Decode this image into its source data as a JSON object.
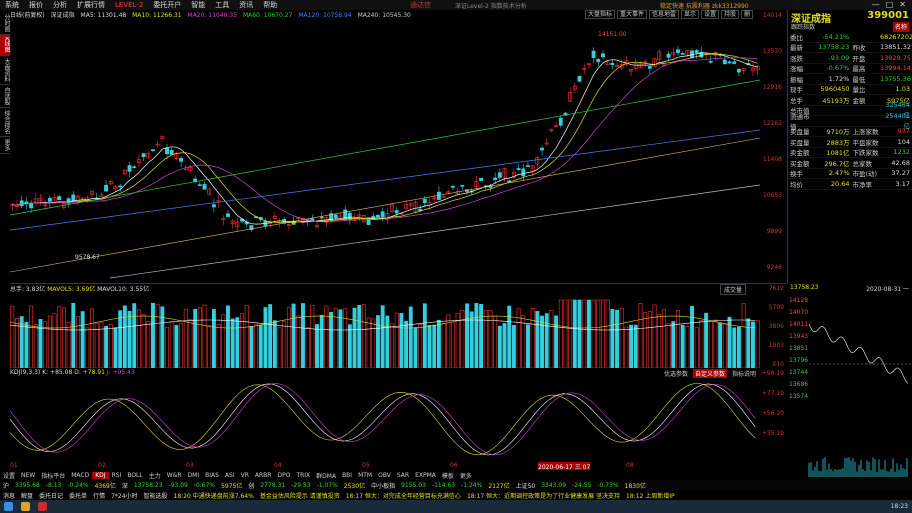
{
  "menu": [
    "系统",
    "报价",
    "分析",
    "扩展行情",
    "LEVEL-2",
    "委托开户",
    "智能",
    "工具",
    "资讯",
    "帮助"
  ],
  "app_title": "通达信",
  "window_subtitle": "深证Level-2  指数技术分析",
  "window_controls": [
    "—",
    "□",
    "✕"
  ],
  "brand_text": "稳定快速 抗震利器  zkk3312990",
  "left_tabs": [
    {
      "label": "分时图",
      "active": false
    },
    {
      "label": "K线图",
      "active": true
    },
    {
      "label": "大盘资料",
      "active": false
    },
    {
      "label": "自选股",
      "active": false
    },
    {
      "label": "综合排名",
      "active": false
    },
    {
      "label": "更多",
      "active": false
    }
  ],
  "header": {
    "period": "日线(前复权)",
    "name": "深证成指",
    "ma5": "MA5: 11301.48",
    "ma10": "MA10: 11266.31",
    "ma20": "MA20: 11046.35",
    "ma60": "MA60: 10670.27",
    "ma120": "MA120: 10758.94",
    "ma240": "MA240: 10545.30"
  },
  "tools": [
    "大盘指标",
    "重大事件",
    "信息地雷",
    "显示",
    "设置",
    "持股",
    "删"
  ],
  "price_axis": [
    "14014",
    "13570",
    "12916",
    "12162",
    "11408",
    "10653",
    "9899",
    "9246"
  ],
  "annotations": {
    "high": "14151.00",
    "low": "9578.67"
  },
  "right_panel": {
    "title": "深证成指",
    "code": "399001",
    "sub_left": "跟踪指数",
    "sub_right": "名称",
    "rows": [
      {
        "l": "委比",
        "v": "-54.21%",
        "l2": "",
        "v2": "68267202",
        "c": "dn",
        "c2": "yw"
      },
      {
        "l": "最新",
        "v": "13758.23",
        "l2": "昨收",
        "v2": "13851.32",
        "c": "dn",
        "c2": "wh"
      },
      {
        "l": "涨跌",
        "v": "-93.09",
        "l2": "开盘",
        "v2": "13929.75",
        "c": "dn",
        "c2": "up"
      },
      {
        "l": "涨幅",
        "v": "-0.67%",
        "l2": "最高",
        "v2": "13994.14",
        "c": "dn",
        "c2": "up"
      },
      {
        "l": "振幅",
        "v": "1.72%",
        "l2": "最低",
        "v2": "13755.36",
        "c": "wh",
        "c2": "dn"
      },
      {
        "l": "现手",
        "v": "5960450",
        "l2": "量比",
        "v2": "1.03",
        "c": "yw",
        "c2": "yw"
      },
      {
        "l": "总手",
        "v": "45193万",
        "l2": "金额",
        "v2": "5975亿",
        "c": "yw",
        "c2": "yw"
      },
      {
        "l": "总市值",
        "v": "",
        "l2": "",
        "v2": "325464亿",
        "c": "yw",
        "c2": "cy"
      },
      {
        "l": "流通市值",
        "v": "",
        "l2": "",
        "v2": "254401亿",
        "c": "yw",
        "c2": "cy"
      },
      {
        "l": "卖盘量",
        "v": "9710万",
        "l2": "上涨家数",
        "v2": "937",
        "c": "yw",
        "c2": "up"
      },
      {
        "l": "买盘量",
        "v": "2883万",
        "l2": "平盘家数",
        "v2": "104",
        "c": "yw",
        "c2": "wh"
      },
      {
        "l": "卖金额",
        "v": "1081亿",
        "l2": "下跌家数",
        "v2": "1232",
        "c": "yw",
        "c2": "dn"
      },
      {
        "l": "买金额",
        "v": "296.7亿",
        "l2": "总家数",
        "v2": "42.68",
        "c": "yw",
        "c2": "wh"
      },
      {
        "l": "换手",
        "v": "2.47%",
        "l2": "市盈(动)",
        "v2": "37.27",
        "c": "yw",
        "c2": "wh"
      },
      {
        "l": "均价",
        "v": "20.64",
        "l2": "市净率",
        "v2": "3.17",
        "c": "yw",
        "c2": "wh"
      }
    ]
  },
  "vol_header": {
    "total": "总手: 3.83亿",
    "mavol5": "MAVOL5: 3.69亿",
    "mavol10": "MAVOL10: 3.55亿"
  },
  "vol_option": "成交量",
  "vol_axis": [
    "7612",
    "5709",
    "3806",
    "1903",
    "X10"
  ],
  "kdj_header": {
    "name": "KDJ(9,3,3)",
    "k": "K: +85.08",
    "d": "D: +78.91",
    "j": "J: +95.43"
  },
  "kdj_buttons": [
    {
      "label": "优选参数",
      "active": false
    },
    {
      "label": "自定义参数",
      "active": true
    },
    {
      "label": "指标说明",
      "active": false
    }
  ],
  "kdj_axis": [
    "+98.19",
    "+77.19",
    "+56.20",
    "+35.19"
  ],
  "date_axis": [
    "01",
    "02",
    "03",
    "04",
    "05",
    "06",
    "2020-06-17 三 07",
    "08"
  ],
  "tabs": [
    {
      "label": "设置",
      "active": false
    },
    {
      "label": "NEW",
      "active": false
    },
    {
      "label": "指标平台",
      "active": false
    },
    {
      "label": "MACD",
      "active": false
    },
    {
      "label": "KDJ",
      "active": true
    },
    {
      "label": "RSI",
      "active": false
    },
    {
      "label": "BOLL",
      "active": false
    },
    {
      "label": "主力",
      "active": false
    },
    {
      "label": "W&R",
      "active": false
    },
    {
      "label": "DMI",
      "active": false
    },
    {
      "label": "BIAS",
      "active": false
    },
    {
      "label": "ASI",
      "active": false
    },
    {
      "label": "VR",
      "active": false
    },
    {
      "label": "ARBR",
      "active": false
    },
    {
      "label": "DPO",
      "active": false
    },
    {
      "label": "TRIX",
      "active": false
    },
    {
      "label": "群DMA",
      "active": false
    },
    {
      "label": "BBI",
      "active": false
    },
    {
      "label": "MTM",
      "active": false
    },
    {
      "label": "OBV",
      "active": false
    },
    {
      "label": "SAR",
      "active": false
    },
    {
      "label": "EXPMA",
      "active": false
    },
    {
      "label": "模板",
      "active": false
    },
    {
      "label": "更多",
      "active": false
    }
  ],
  "mini": {
    "price": "13758.23",
    "date": "2020-08-31 一",
    "axis": [
      "14128",
      "14070",
      "14011",
      "13943",
      "13851",
      "13796",
      "13744",
      "13686",
      "13574"
    ],
    "pct": [
      "2.00%",
      "1.58%",
      "1.16%",
      "0.73%",
      "0.31%",
      "0.00%",
      "0.73%",
      "1.16%",
      "2.00%"
    ]
  },
  "status": [
    {
      "t": "沪",
      "c": "wh"
    },
    {
      "t": "3395.68",
      "c": "dn"
    },
    {
      "t": "-8.13",
      "c": "dn"
    },
    {
      "t": "-0.24%",
      "c": "dn"
    },
    {
      "t": "4369亿",
      "c": "yw"
    },
    {
      "t": "深",
      "c": "wh"
    },
    {
      "t": "13758.23",
      "c": "dn"
    },
    {
      "t": "-93.09",
      "c": "dn"
    },
    {
      "t": "-0.67%",
      "c": "dn"
    },
    {
      "t": "5975亿",
      "c": "yw"
    },
    {
      "t": "创",
      "c": "wh"
    },
    {
      "t": "2778.31",
      "c": "dn"
    },
    {
      "t": "-29.53",
      "c": "dn"
    },
    {
      "t": "-1.07%",
      "c": "dn"
    },
    {
      "t": "2530亿",
      "c": "yw"
    },
    {
      "t": "中小板指",
      "c": "wh"
    },
    {
      "t": "9155.03",
      "c": "dn"
    },
    {
      "t": "-114.63",
      "c": "dn"
    },
    {
      "t": "-1.24%",
      "c": "dn"
    },
    {
      "t": "2127亿",
      "c": "yw"
    },
    {
      "t": "上证50",
      "c": "wh"
    },
    {
      "t": "3343.09",
      "c": "dn"
    },
    {
      "t": "-24.55",
      "c": "dn"
    },
    {
      "t": "-0.73%",
      "c": "dn"
    },
    {
      "t": "1830亿",
      "c": "yw"
    }
  ],
  "news": [
    {
      "t": "消息",
      "c": "wh"
    },
    {
      "t": "解盘",
      "c": "wh"
    },
    {
      "t": "委托日记",
      "c": "wh"
    },
    {
      "t": "委托单",
      "c": "wh"
    },
    {
      "t": "行情",
      "c": "wh"
    },
    {
      "t": "7*24小时",
      "c": "wh"
    },
    {
      "t": "智能选股",
      "c": "wh"
    },
    {
      "t": "18:20 中通快递盘前涨7.64%",
      "c": "yw"
    },
    {
      "t": "基金益估风险提示 请谨慎投资",
      "c": "yw"
    },
    {
      "t": "18:17 恒大：对完成全年经营目标充满信心",
      "c": "yw"
    },
    {
      "t": "18:17 恒大：近期调控政策是为了行业健康发展 坚决支持",
      "c": "yw"
    },
    {
      "t": "18:12 上周新增IP",
      "c": "yw"
    }
  ],
  "clock": "18:23"
}
